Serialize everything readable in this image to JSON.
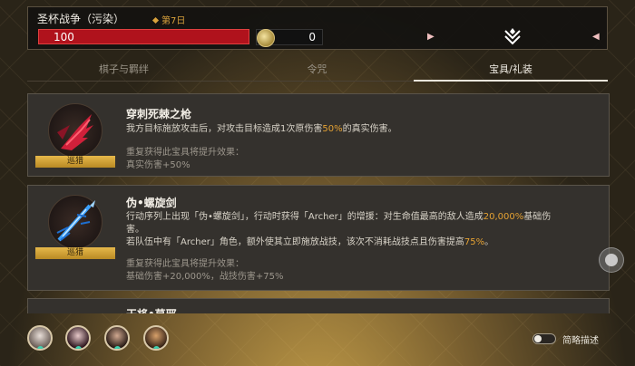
{
  "header": {
    "title": "圣杯战争（污染）",
    "day": "第7日",
    "hp": "100",
    "coins": "0"
  },
  "tabs": [
    {
      "label": "棋子与羁绊"
    },
    {
      "label": "令咒"
    },
    {
      "label": "宝具/礼装",
      "active": true
    }
  ],
  "items": [
    {
      "name": "穿刺死棘之枪",
      "badge": "巡猎",
      "desc_a": "我方目标施放攻击后，对攻击目标造成1次原伤害",
      "desc_hl": "50%",
      "desc_b": "的真实伤害。",
      "upgrade_title": "重复获得此宝具将提升效果：",
      "upgrade_line": "真实伤害+50%"
    },
    {
      "name": "伪•螺旋剑",
      "badge": "巡猎",
      "desc1_a": "行动序列上出现「伪•螺旋剑」，行动时获得「Archer」的增援：对生命值最高的敌人造成",
      "desc1_hl": "20,000%",
      "desc1_b": "基础伤",
      "desc1_c": "害。",
      "desc2_a": "若队伍中有「Archer」角色，额外使其立即施放战技，该次不消耗战技点且伤害提高",
      "desc2_hl": "75%",
      "desc2_b": "。",
      "upgrade_title": "重复获得此宝具将提升效果：",
      "upgrade_line": "基础伤害+20,000%，战技伤害+75%"
    },
    {
      "name": "干将•莫邪"
    }
  ],
  "footer": {
    "toggle_label": "简略描述"
  },
  "colors": {
    "accent_gold": "#e5a233",
    "hp_red": "#b0121c",
    "badge_gold": "#e6b84a",
    "status_teal": "#3fd1b0"
  }
}
